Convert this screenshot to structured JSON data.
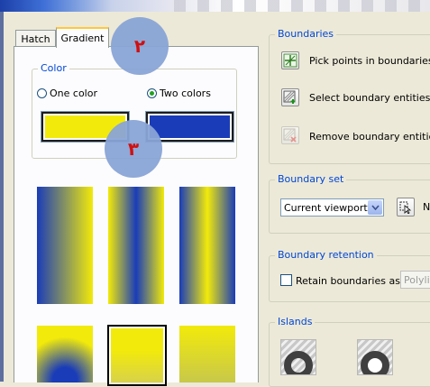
{
  "tabs": {
    "hatch": "Hatch",
    "gradient": "Gradient"
  },
  "color": {
    "title": "Color",
    "one_color": "One color",
    "two_colors": "Two colors",
    "selected": "two_colors",
    "color1": "#f2ea0a",
    "color2": "#1a3cb8"
  },
  "callouts": {
    "first": "٢",
    "second": "٣"
  },
  "gradient_tiles": [
    {
      "name": "linear",
      "selected": false
    },
    {
      "name": "cylinder",
      "selected": false
    },
    {
      "name": "inverted-cylinder",
      "selected": false
    },
    {
      "name": "spherical",
      "selected": false
    },
    {
      "name": "hemispherical",
      "selected": true
    },
    {
      "name": "curved",
      "selected": false
    }
  ],
  "boundaries": {
    "title": "Boundaries",
    "pick_points": "Pick points in boundaries",
    "select_entities": "Select boundary entities",
    "remove_entities": "Remove boundary entities"
  },
  "boundary_set": {
    "title": "Boundary set",
    "current_value": "Current viewport",
    "new_label": "N"
  },
  "boundary_retention": {
    "title": "Boundary retention",
    "retain_label": "Retain boundaries as",
    "retain_checked": false,
    "object_type": "Polylin"
  },
  "islands": {
    "title": "Islands"
  }
}
